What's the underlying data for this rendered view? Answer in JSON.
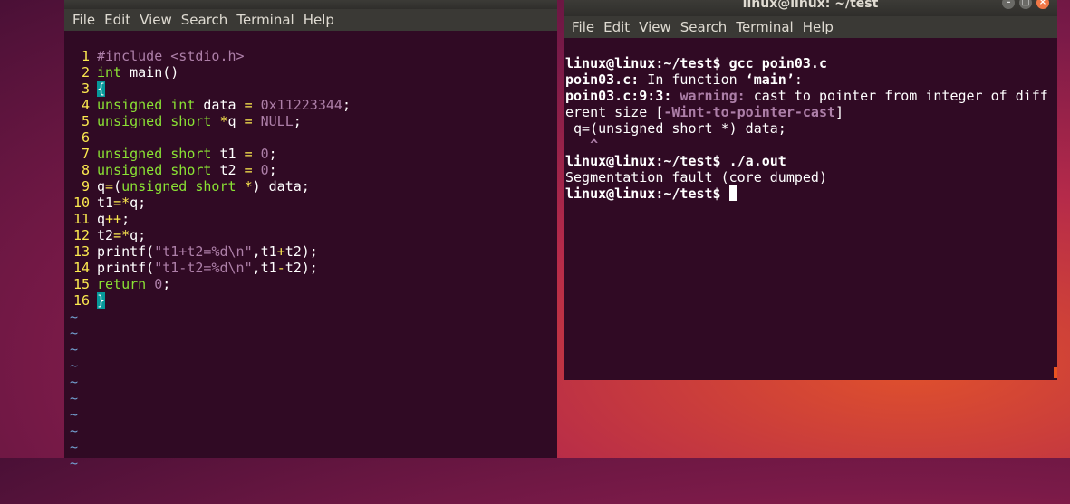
{
  "left_window": {
    "menu": [
      "File",
      "Edit",
      "View",
      "Search",
      "Terminal",
      "Help"
    ],
    "code_lines": [
      {
        "n": "1",
        "text": "#include <stdio.h>"
      },
      {
        "n": "2",
        "text": "int main()"
      },
      {
        "n": "3",
        "text": "{"
      },
      {
        "n": "4",
        "text": "unsigned int data = 0x11223344;"
      },
      {
        "n": "5",
        "text": "unsigned short *q = NULL;"
      },
      {
        "n": "6",
        "text": ""
      },
      {
        "n": "7",
        "text": "unsigned short t1 = 0;"
      },
      {
        "n": "8",
        "text": "unsigned short t2 = 0;"
      },
      {
        "n": "9",
        "text": "q=(unsigned short *) data;"
      },
      {
        "n": "10",
        "text": "t1=*q;"
      },
      {
        "n": "11",
        "text": "q++;"
      },
      {
        "n": "12",
        "text": "t2=*q;"
      },
      {
        "n": "13",
        "text": "printf(\"t1+t2=%d\\n\",t1+t2);"
      },
      {
        "n": "14",
        "text": "printf(\"t1-t2=%d\\n\",t1-t2);"
      },
      {
        "n": "15",
        "text": "return 0;"
      },
      {
        "n": "16",
        "text": "}"
      }
    ],
    "tilde": "~"
  },
  "right_window": {
    "title": "linux@linux: ~/test",
    "menu": [
      "File",
      "Edit",
      "View",
      "Search",
      "Terminal",
      "Help"
    ],
    "lines": [
      "linux@linux:~/test$ gcc poin03.c",
      "poin03.c: In function ‘main’:",
      "poin03.c:9:3: warning: cast to pointer from integer of diff",
      "erent size [-Wint-to-pointer-cast]",
      " q=(unsigned short *) data;",
      "   ^",
      "linux@linux:~/test$ ./a.out",
      "Segmentation fault (core dumped)",
      "linux@linux:~/test$ "
    ]
  }
}
